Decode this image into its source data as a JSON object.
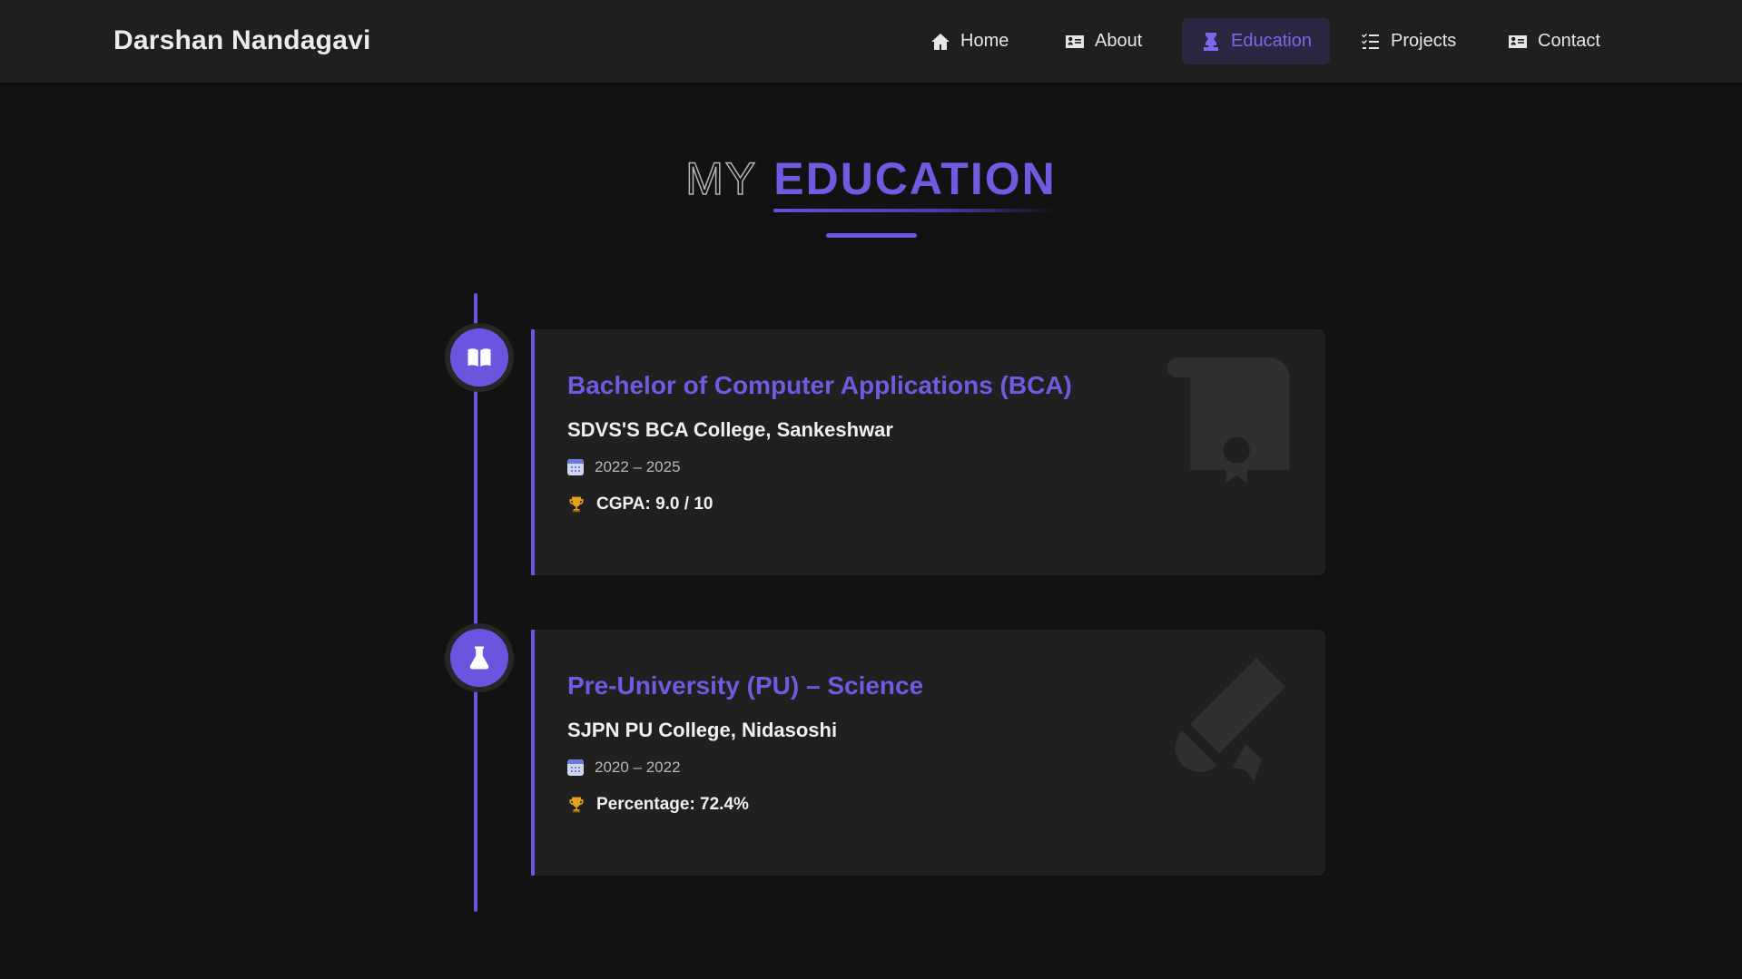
{
  "brand": "Darshan Nandagavi",
  "nav": {
    "items": [
      {
        "label": "Home",
        "icon": "home-icon"
      },
      {
        "label": "About",
        "icon": "id-card-icon"
      },
      {
        "label": "Education",
        "icon": "graduate-icon",
        "active": true
      },
      {
        "label": "Projects",
        "icon": "list-icon"
      },
      {
        "label": "Contact",
        "icon": "contact-card-icon"
      }
    ]
  },
  "section": {
    "title_prefix": "MY",
    "title_highlight": "EDUCATION"
  },
  "education": [
    {
      "degree": "Bachelor of Computer Applications (BCA)",
      "institute": "SDVS'S BCA College, Sankeshwar",
      "years": "2022 – 2025",
      "score": "CGPA: 9.0 / 10",
      "icon": "book-open-icon",
      "bg_icon": "certificate-icon"
    },
    {
      "degree": "Pre-University (PU) – Science",
      "institute": "SJPN PU College, Nidasoshi",
      "years": "2020 – 2022",
      "score": "Percentage: 72.4%",
      "icon": "flask-icon",
      "bg_icon": "scroll-icon"
    }
  ],
  "colors": {
    "accent": "#6a55e0",
    "background": "#121212",
    "navbar": "#1f1f1f",
    "card": "#202020"
  }
}
